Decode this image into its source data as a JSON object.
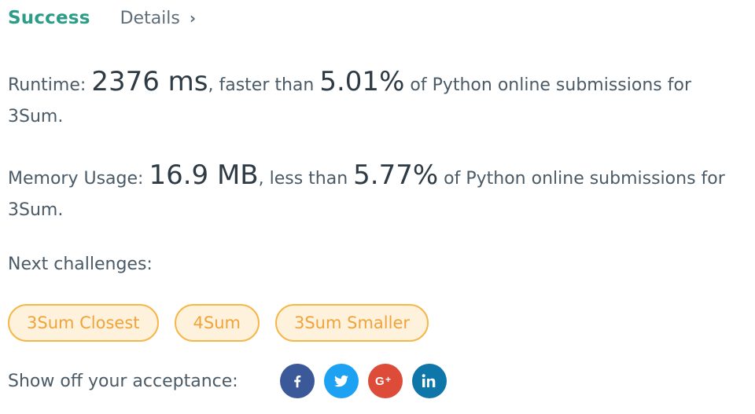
{
  "header": {
    "status": "Success",
    "details_label": "Details",
    "details_chevron": "›"
  },
  "runtime": {
    "label": "Runtime:",
    "value": "2376 ms",
    "comparison": ", faster than",
    "percent": "5.01%",
    "suffix": "of Python online submissions for 3Sum."
  },
  "memory": {
    "label": "Memory Usage:",
    "value": "16.9 MB",
    "comparison": ", less than",
    "percent": "5.77%",
    "suffix": "of Python online submissions for 3Sum."
  },
  "next": {
    "label": "Next challenges:",
    "challenges": [
      "3Sum Closest",
      "4Sum",
      "3Sum Smaller"
    ]
  },
  "share": {
    "label": "Show off your acceptance:",
    "networks": [
      {
        "name": "facebook-icon",
        "color": "#3b5998"
      },
      {
        "name": "twitter-icon",
        "color": "#1da1f2"
      },
      {
        "name": "google-plus-icon",
        "color": "#dd4b39"
      },
      {
        "name": "linkedin-icon",
        "color": "#0e76a8"
      }
    ]
  },
  "colors": {
    "success": "#2b9c87",
    "chip_border": "#f4b74a",
    "chip_bg": "#fff2dc",
    "chip_text": "#f0a33a"
  }
}
